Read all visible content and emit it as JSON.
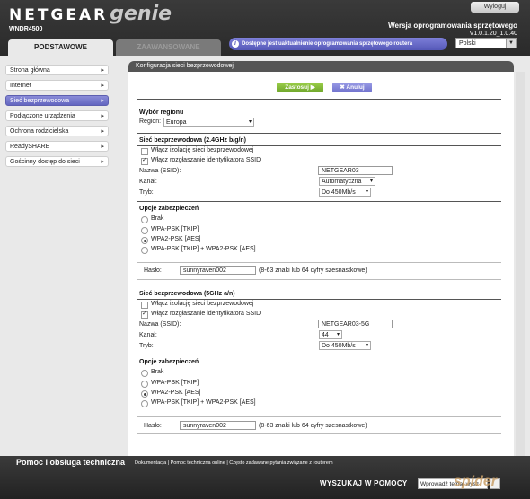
{
  "header": {
    "brand": "NETGEAR",
    "product": "genie",
    "model": "WNDR4500",
    "logout": "Wyloguj",
    "fw_title": "Wersja oprogramowania sprzętowego",
    "fw_version": "V1.0.1.20_1.0.40",
    "tabs": [
      {
        "label": "PODSTAWOWE"
      },
      {
        "label": "ZAAWANSOWANE"
      }
    ],
    "update_notice": "Dostępne jest uaktualnienie oprogramowania sprzętowego routera",
    "language": "Polski"
  },
  "sidebar": {
    "items": [
      {
        "label": "Strona główna"
      },
      {
        "label": "Internet"
      },
      {
        "label": "Sieć bezprzewodowa"
      },
      {
        "label": "Podłączone urządzenia"
      },
      {
        "label": "Ochrona rodzicielska"
      },
      {
        "label": "ReadySHARE"
      },
      {
        "label": "Gościnny dostęp do sieci"
      }
    ]
  },
  "main": {
    "title": "Konfiguracja sieci bezprzewodowej",
    "apply": "Zastosuj",
    "cancel": "Anuluj",
    "region": {
      "heading": "Wybór regionu",
      "label": "Region:",
      "value": "Europa"
    },
    "band24": {
      "heading": "Sieć bezprzewodowa (2.4GHz b/g/n)",
      "isolation": "Włącz izolację sieci bezprzewodowej",
      "broadcast": "Włącz rozgłaszanie identyfikatora SSID",
      "ssid_label": "Nazwa (SSID):",
      "ssid": "NETGEAR03",
      "channel_label": "Kanał:",
      "channel": "Automatyczna",
      "mode_label": "Tryb:",
      "mode": "Do 450Mb/s",
      "security_heading": "Opcje zabezpieczeń",
      "security_options": [
        "Brak",
        "WPA-PSK [TKIP]",
        "WPA2-PSK [AES]",
        "WPA-PSK [TKIP] + WPA2-PSK [AES]"
      ],
      "password_label": "Hasło:",
      "password": "sunnyraven002",
      "password_hint": "(8-63 znaki lub 64 cyfry szesnastkowe)"
    },
    "band5": {
      "heading": "Sieć bezprzewodowa (5GHz a/n)",
      "isolation": "Włącz izolację sieci bezprzewodowej",
      "broadcast": "Włącz rozgłaszanie identyfikatora SSID",
      "ssid_label": "Nazwa (SSID):",
      "ssid": "NETGEAR03-5G",
      "channel_label": "Kanał:",
      "channel": "44",
      "mode_label": "Tryb:",
      "mode": "Do 450Mb/s",
      "security_heading": "Opcje zabezpieczeń",
      "security_options": [
        "Brak",
        "WPA-PSK [TKIP]",
        "WPA2-PSK [AES]",
        "WPA-PSK [TKIP] + WPA2-PSK [AES]"
      ],
      "password_label": "Hasło:",
      "password": "sunnyraven002",
      "password_hint": "(8-63 znaki lub 64 cyfry szesnastkowe)"
    }
  },
  "footer": {
    "help_title": "Pomoc i obsługa techniczna",
    "links": "Dokumentacja | Pomoc techniczna online | Często zadawane pytania związane z routerem",
    "search_label": "WYSZUKAJ W POMOCY",
    "search_value": "Wprowadź temat wysz",
    "watermark": "spider"
  }
}
